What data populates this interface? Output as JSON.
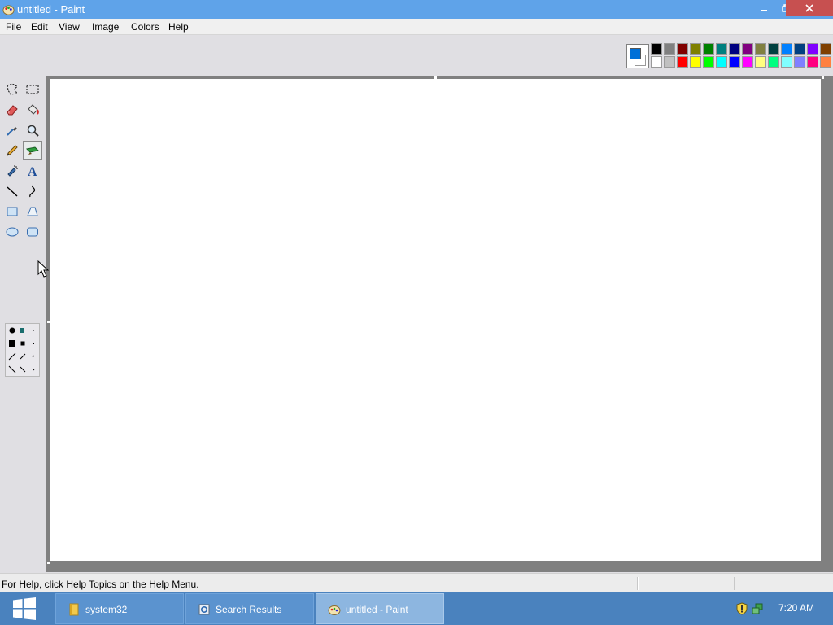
{
  "window": {
    "title": "untitled - Paint",
    "controls": {
      "minimize": "minimize-icon",
      "restore": "restore-icon",
      "close": "close-icon"
    }
  },
  "menu": {
    "items": [
      "File",
      "Edit",
      "View",
      "Image",
      "Colors",
      "Help"
    ]
  },
  "colors": {
    "primary": "#0070d8",
    "secondary": "#ffffff",
    "palette_top": [
      "#000000",
      "#808080",
      "#800000",
      "#808000",
      "#008000",
      "#008080",
      "#000080",
      "#800080",
      "#808040",
      "#004040",
      "#0080ff",
      "#004080",
      "#8000ff",
      "#804000"
    ],
    "palette_bottom": [
      "#ffffff",
      "#c0c0c0",
      "#ff0000",
      "#ffff00",
      "#00ff00",
      "#00ffff",
      "#0000ff",
      "#ff00ff",
      "#ffff80",
      "#00ff80",
      "#80ffff",
      "#8080ff",
      "#ff0080",
      "#ff8040"
    ]
  },
  "tools": [
    {
      "name": "free-form-select-icon"
    },
    {
      "name": "select-icon"
    },
    {
      "name": "eraser-icon"
    },
    {
      "name": "fill-icon"
    },
    {
      "name": "pick-color-icon"
    },
    {
      "name": "magnifier-icon"
    },
    {
      "name": "pencil-icon"
    },
    {
      "name": "brush-icon",
      "selected": true
    },
    {
      "name": "airbrush-icon"
    },
    {
      "name": "text-icon",
      "glyph": "A"
    },
    {
      "name": "line-icon"
    },
    {
      "name": "curve-icon"
    },
    {
      "name": "rectangle-icon"
    },
    {
      "name": "polygon-icon"
    },
    {
      "name": "ellipse-icon"
    },
    {
      "name": "rounded-rectangle-icon"
    }
  ],
  "statusbar": {
    "help_text": "For Help, click Help Topics on the Help Menu."
  },
  "taskbar": {
    "items": [
      {
        "label": "system32",
        "icon": "folder-icon"
      },
      {
        "label": "Search Results",
        "icon": "search-results-icon"
      },
      {
        "label": "untitled - Paint",
        "icon": "paint-icon",
        "active": true
      }
    ],
    "clock": "7:20 AM"
  }
}
